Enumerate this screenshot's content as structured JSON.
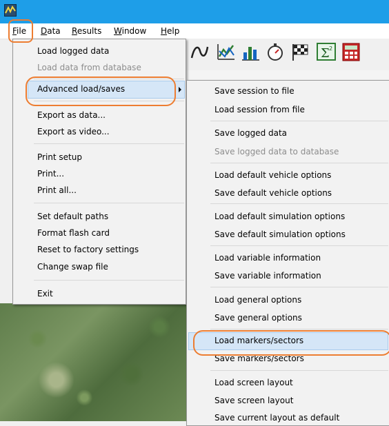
{
  "menubar": {
    "items": [
      {
        "pre": "",
        "u": "F",
        "post": "ile"
      },
      {
        "pre": "",
        "u": "D",
        "post": "ata"
      },
      {
        "pre": "",
        "u": "R",
        "post": "esults"
      },
      {
        "pre": "",
        "u": "W",
        "post": "indow"
      },
      {
        "pre": "",
        "u": "H",
        "post": "elp"
      }
    ]
  },
  "file_menu": {
    "items": [
      "Load logged data",
      "Load data from database",
      "Advanced load/saves",
      "Export as data...",
      "Export as video...",
      "Print setup",
      "Print...",
      "Print all...",
      "Set default paths",
      "Format flash card",
      "Reset to factory settings",
      "Change swap file",
      "Exit"
    ],
    "disabled": [
      "Load data from database"
    ],
    "highlighted": "Advanced load/saves"
  },
  "submenu": {
    "items": [
      "Save session to file",
      "Load session from file",
      "Save logged data",
      "Save logged data to database",
      "Load default vehicle options",
      "Save default vehicle options",
      "Load default simulation options",
      "Save default simulation options",
      "Load variable information",
      "Save variable information",
      "Load general options",
      "Save general options",
      "Load markers/sectors",
      "Save markers/sectors",
      "Load screen layout",
      "Save screen layout",
      "Save current layout as default"
    ],
    "disabled": [
      "Save logged data to database"
    ],
    "highlighted": "Load markers/sectors"
  },
  "toolbar": {
    "icons": [
      "line-graph-icon",
      "xy-plot-icon",
      "bar-chart-icon",
      "stopwatch-icon",
      "checkered-flag-icon",
      "sigma-icon",
      "calculator-icon"
    ]
  },
  "colors": {
    "titlebar": "#1e9ee8",
    "menu_highlight": "#d5e6f7",
    "annotation_ring": "#ed7d31"
  }
}
